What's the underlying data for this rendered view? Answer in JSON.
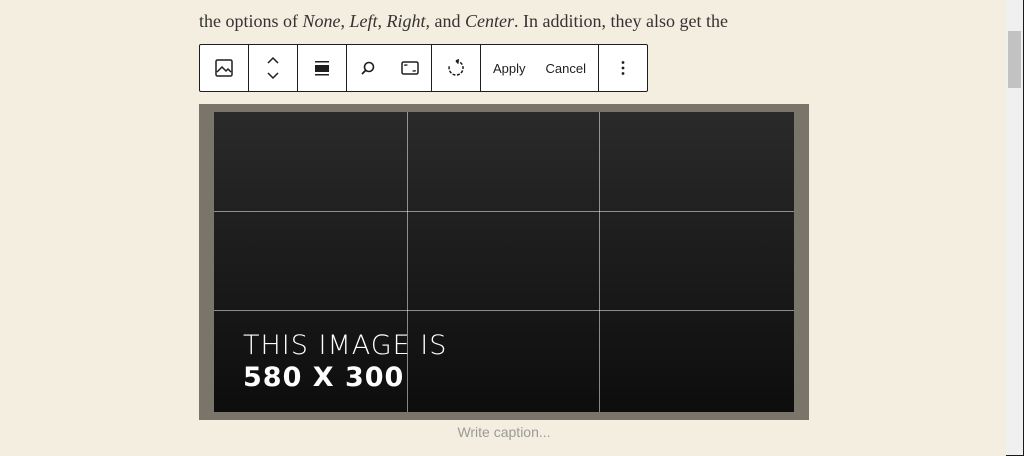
{
  "paragraph": {
    "prefix": "the options of ",
    "opt1": "None",
    "sep1": ", ",
    "opt2": "Left",
    "sep2": ", ",
    "opt3": "Right,",
    "sep3": " and ",
    "opt4": "Center",
    "suffix": ". In addition, they also get the"
  },
  "toolbar": {
    "image_icon": "image-icon",
    "move_icon": "chevron-up-down-icon",
    "align_icon": "align-wide-icon",
    "zoom_icon": "search-icon",
    "aspect_icon": "aspect-ratio-icon",
    "rotate_icon": "rotate-icon",
    "apply_label": "Apply",
    "cancel_label": "Cancel",
    "more_icon": "more-vertical-icon"
  },
  "image": {
    "line1": "THIS IMAGE IS",
    "line2": "580 X 300"
  },
  "caption": {
    "placeholder": "Write caption..."
  },
  "colors": {
    "page_bg": "#f4eee0",
    "image_frame": "#7a756b",
    "toolbar_border": "#1e1e1e"
  }
}
